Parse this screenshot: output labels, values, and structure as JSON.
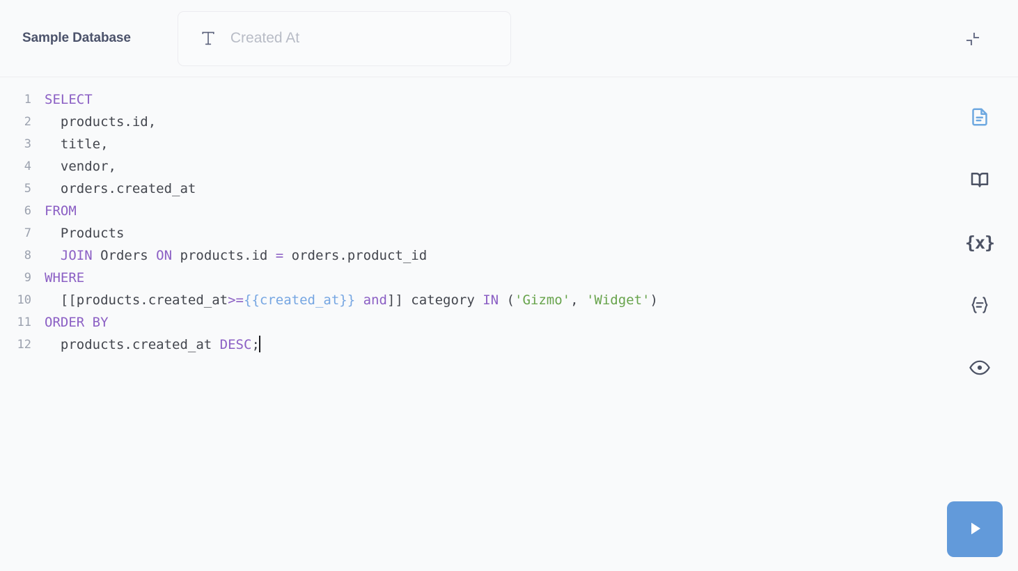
{
  "header": {
    "database_name": "Sample Database",
    "name_field": {
      "value": "",
      "placeholder": "Created At",
      "type_icon": "text-type-icon"
    },
    "collapse_icon": "collapse-arrows-icon"
  },
  "editor": {
    "line_numbers": [
      "1",
      "2",
      "3",
      "4",
      "5",
      "6",
      "7",
      "8",
      "9",
      "10",
      "11",
      "12"
    ],
    "lines": [
      [
        {
          "t": "SELECT",
          "c": "kw"
        }
      ],
      [
        {
          "t": "  products.id,",
          "c": "id"
        }
      ],
      [
        {
          "t": "  title,",
          "c": "id"
        }
      ],
      [
        {
          "t": "  vendor,",
          "c": "id"
        }
      ],
      [
        {
          "t": "  orders.created_at",
          "c": "id"
        }
      ],
      [
        {
          "t": "FROM",
          "c": "kw"
        }
      ],
      [
        {
          "t": "  Products",
          "c": "id"
        }
      ],
      [
        {
          "t": "  ",
          "c": "id"
        },
        {
          "t": "JOIN",
          "c": "kw"
        },
        {
          "t": " Orders ",
          "c": "id"
        },
        {
          "t": "ON",
          "c": "kw"
        },
        {
          "t": " products.id ",
          "c": "id"
        },
        {
          "t": "=",
          "c": "op"
        },
        {
          "t": " orders.product_id",
          "c": "id"
        }
      ],
      [
        {
          "t": "WHERE",
          "c": "kw"
        }
      ],
      [
        {
          "t": "  [[products.created_at",
          "c": "id"
        },
        {
          "t": ">=",
          "c": "op"
        },
        {
          "t": "{{created_at}}",
          "c": "tmpl"
        },
        {
          "t": " ",
          "c": "id"
        },
        {
          "t": "and",
          "c": "kw"
        },
        {
          "t": "]] category ",
          "c": "id"
        },
        {
          "t": "IN",
          "c": "kw"
        },
        {
          "t": " (",
          "c": "punc"
        },
        {
          "t": "'Gizmo'",
          "c": "str"
        },
        {
          "t": ", ",
          "c": "punc"
        },
        {
          "t": "'Widget'",
          "c": "str"
        },
        {
          "t": ")",
          "c": "punc"
        }
      ],
      [
        {
          "t": "ORDER BY",
          "c": "kw"
        }
      ],
      [
        {
          "t": "  products.created_at ",
          "c": "id"
        },
        {
          "t": "DESC",
          "c": "kw"
        },
        {
          "t": ";",
          "c": "punc"
        },
        {
          "t": "",
          "c": "caret"
        }
      ]
    ],
    "raw_sql": "SELECT\n  products.id,\n  title,\n  vendor,\n  orders.created_at\nFROM\n  Products\n  JOIN Orders ON products.id = orders.product_id\nWHERE\n  [[products.created_at>={{created_at}} and]] category IN ('Gizmo', 'Widget')\nORDER BY\n  products.created_at DESC;"
  },
  "rail": {
    "buttons": [
      {
        "name": "data-reference-icon",
        "icon": "document",
        "active": true
      },
      {
        "name": "snippet-sidebar-icon",
        "icon": "book",
        "active": false
      },
      {
        "name": "variables-icon",
        "icon": "braces-x",
        "glyph": "{x}",
        "active": false
      },
      {
        "name": "format-query-icon",
        "icon": "braces-lines",
        "glyph": "{=}",
        "active": false
      },
      {
        "name": "preview-query-icon",
        "icon": "eye",
        "active": false
      }
    ]
  },
  "run_button": {
    "icon": "play-icon",
    "color": "#629ada"
  },
  "colors": {
    "background": "#f9fafb",
    "keyword": "#8b5fc4",
    "string": "#67a34b",
    "template_variable": "#76a6e2",
    "identifier": "#43464e",
    "line_number": "#9ba1ae",
    "title": "#4c536b",
    "placeholder": "#b8bcc6",
    "accent_blue": "#629ada"
  }
}
